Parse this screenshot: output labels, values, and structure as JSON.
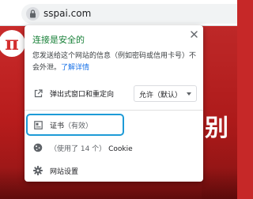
{
  "address_bar": {
    "url": "sspai.com",
    "site_info_icon": "lock-icon"
  },
  "page": {
    "logo_text": "π",
    "banner_char": "别 "
  },
  "popup": {
    "title": "连接是安全的",
    "description": "您发送给这个网站的信息（例如密码或信用卡号）不会外泄。",
    "learn_more": "了解详情",
    "close_icon": "close-icon",
    "popups_label": "弹出式窗口和重定向",
    "popups_value": "允许（默认）",
    "certificate_label": "证书",
    "certificate_status": "（有效）",
    "cookies_count": "（使用了 14 个）",
    "cookies_label": "Cookie",
    "site_settings_label": "网站设置"
  },
  "colors": {
    "secure_green": "#188038",
    "link_blue": "#1a73e8",
    "highlight": "#1e9bd7",
    "page_red": "#c62828"
  }
}
